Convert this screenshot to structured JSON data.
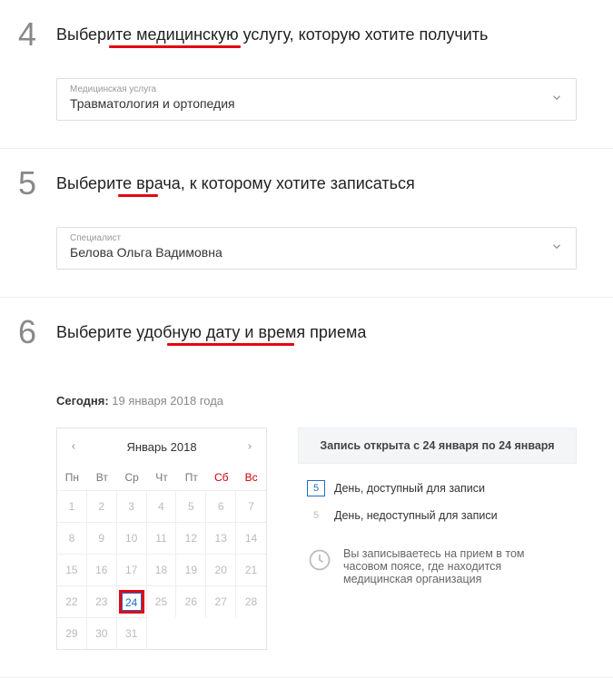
{
  "step4": {
    "num": "4",
    "title": "Выберите медицинскую услугу, которую хотите получить",
    "dropdown_label": "Медицинская услуга",
    "dropdown_value": "Травматология и ортопедия"
  },
  "step5": {
    "num": "5",
    "title": "Выберите врача, к которому хотите записаться",
    "dropdown_label": "Специалист",
    "dropdown_value": "Белова Ольга Вадимовна"
  },
  "step6": {
    "num": "6",
    "title": "Выберите удобную дату и время приема",
    "today_label": "Сегодня:",
    "today_date": " 19 января 2018 года",
    "cal_month": "Январь 2018",
    "dow": [
      "Пн",
      "Вт",
      "Ср",
      "Чт",
      "Пт",
      "Сб",
      "Вс"
    ],
    "days": [
      {
        "n": "1"
      },
      {
        "n": "2"
      },
      {
        "n": "3"
      },
      {
        "n": "4"
      },
      {
        "n": "5"
      },
      {
        "n": "6"
      },
      {
        "n": "7"
      },
      {
        "n": "8"
      },
      {
        "n": "9"
      },
      {
        "n": "10"
      },
      {
        "n": "11"
      },
      {
        "n": "12"
      },
      {
        "n": "13"
      },
      {
        "n": "14"
      },
      {
        "n": "15"
      },
      {
        "n": "16"
      },
      {
        "n": "17"
      },
      {
        "n": "18"
      },
      {
        "n": "19"
      },
      {
        "n": "20"
      },
      {
        "n": "21"
      },
      {
        "n": "22"
      },
      {
        "n": "23"
      },
      {
        "n": "24",
        "avail": true,
        "picked": true
      },
      {
        "n": "25"
      },
      {
        "n": "26"
      },
      {
        "n": "27"
      },
      {
        "n": "28"
      },
      {
        "n": "29"
      },
      {
        "n": "30"
      },
      {
        "n": "31"
      }
    ],
    "banner": "Запись открыта с 24 января по 24 января",
    "legend_num": "5",
    "legend_avail": "День, доступный для записи",
    "legend_unavail": "День, недоступный для записи",
    "tz_note": "Вы записываетесь на прием в том часовом поясе, где находится медицинская организация"
  }
}
